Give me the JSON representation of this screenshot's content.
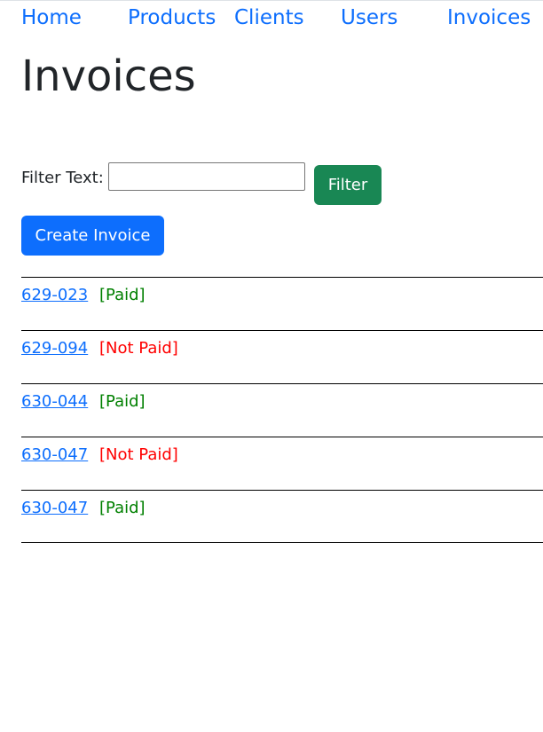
{
  "nav": {
    "items": [
      {
        "label": "Home",
        "name": "nav-home"
      },
      {
        "label": "Products",
        "name": "nav-products"
      },
      {
        "label": "Clients",
        "name": "nav-clients"
      },
      {
        "label": "Users",
        "name": "nav-users"
      },
      {
        "label": "Invoices",
        "name": "nav-invoices"
      }
    ]
  },
  "page": {
    "title": "Invoices"
  },
  "filter": {
    "label": "Filter Text:",
    "value": "",
    "placeholder": "",
    "button_label": "Filter"
  },
  "actions": {
    "create_label": "Create Invoice"
  },
  "colors": {
    "link": "#0d6efd",
    "primary_button": "#0d6efd",
    "filter_button": "#198754",
    "paid": "#008000",
    "not_paid": "#ff0000"
  },
  "invoices": [
    {
      "number": "629-023",
      "status": "[Paid]",
      "paid": true
    },
    {
      "number": "629-094",
      "status": "[Not Paid]",
      "paid": false
    },
    {
      "number": "630-044",
      "status": "[Paid]",
      "paid": true
    },
    {
      "number": "630-047",
      "status": "[Not Paid]",
      "paid": false
    },
    {
      "number": "630-047",
      "status": "[Paid]",
      "paid": true
    }
  ]
}
